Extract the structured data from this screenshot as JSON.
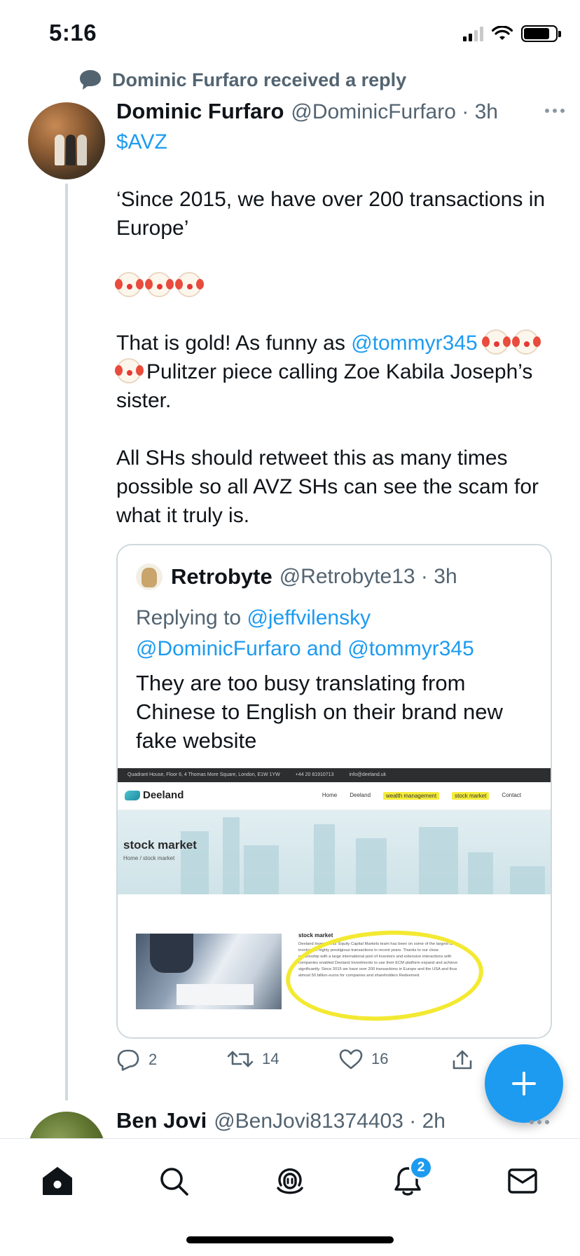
{
  "status_bar": {
    "time": "5:16"
  },
  "social_context": {
    "text": "Dominic Furfaro received a reply"
  },
  "tweet": {
    "author_name": "Dominic Furfaro",
    "author_handle": "@DominicFurfaro",
    "time": "3h",
    "cashtag": "$AVZ",
    "line_quote": "‘Since 2015, we have over 200 transactions in Europe’",
    "line_gold_prefix": "That is gold! As funny as",
    "mention_tommy": "@tommyr345",
    "line_gold_suffix": "Pulitzer piece calling Zoe Kabila Joseph’s sister.",
    "line_retweet": "All SHs should retweet this as many times possible so all AVZ SHs can see the scam for what it truly is.",
    "actions": {
      "replies": "2",
      "retweets": "14",
      "likes": "16"
    }
  },
  "quote": {
    "author_name": "Retrobyte",
    "author_handle": "@Retrobyte13",
    "time": "3h",
    "replying_prefix": "Replying to",
    "mention_jeff": "@jeffvilensky",
    "mention_dominic": "@DominicFurfaro",
    "and_word": "and",
    "mention_tommy": "@tommyr345",
    "text": "They are too busy translating from Chinese to English on their brand new fake website"
  },
  "quote_media": {
    "topbar_address": "Quadrant House, Floor 6, 4 Thomas More Square, London, E1W 1YW",
    "topbar_phone": "+44 20 81910713",
    "topbar_email": "info@deeland.uk",
    "logo": "Deeland",
    "menu": [
      "Home",
      "Deeland",
      "wealth management",
      "stock market",
      "Contact"
    ],
    "hero_title": "stock market",
    "hero_breadcrumb": "Home / stock market",
    "section_title": "stock market",
    "section_body": "Deeland Investments' Equity Capital Markets team has been on some of the largest and involved in highly prestigious transactions in recent years. Thanks to our close relationship with a large international pool of investors and extensive interactions with companies enabled Deeland Investments to use their ECM platform expand and achieve significantly. Since 2015 we have over 200 transactions in Europe and the USA and thus almost 50 billion euros for companies and shareholders Redeemed.",
    "highlight_color": "#f3e932"
  },
  "next_tweet": {
    "author_name": "Ben Jovi",
    "author_handle": "@BenJovi81374403",
    "time": "2h"
  },
  "tab_bar": {
    "notifications_badge": "2"
  },
  "colors": {
    "accent": "#1d9bf0",
    "secondary_text": "#536471",
    "primary_text": "#0f1419"
  }
}
